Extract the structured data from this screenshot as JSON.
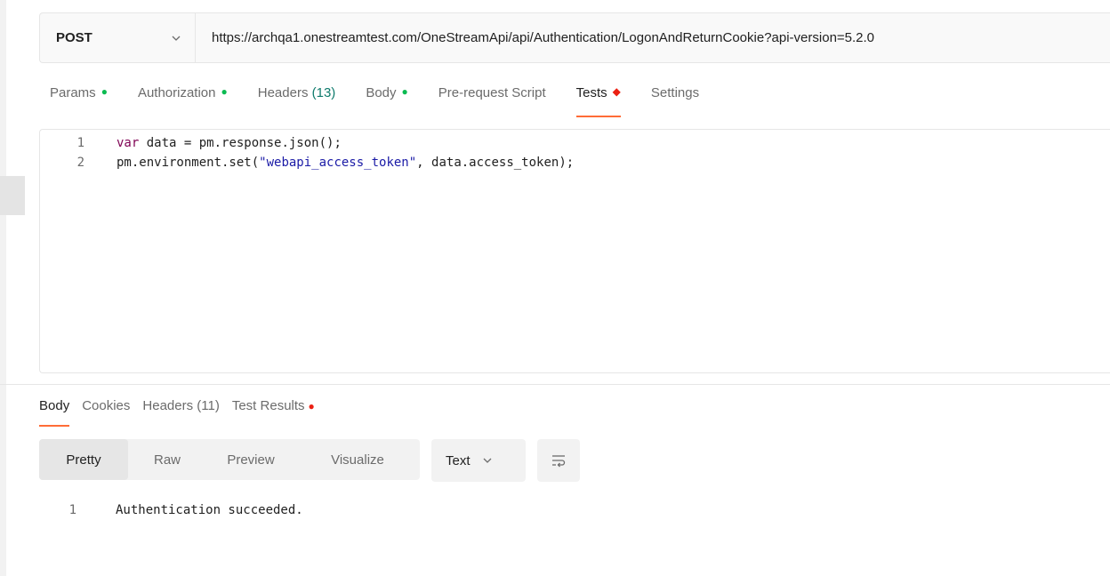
{
  "request": {
    "method": "POST",
    "url": "https://archqa1.onestreamtest.com/OneStreamApi/api/Authentication/LogonAndReturnCookie?api-version=5.2.0"
  },
  "request_tabs": [
    {
      "label": "Params",
      "indicator": "●"
    },
    {
      "label": "Authorization",
      "indicator": "●"
    },
    {
      "label": "Headers",
      "count": "(13)"
    },
    {
      "label": "Body",
      "indicator": "●"
    },
    {
      "label": "Pre-request Script"
    },
    {
      "label": "Tests",
      "indicator": "◆"
    },
    {
      "label": "Settings"
    }
  ],
  "editor": {
    "lines": [
      {
        "num": "1",
        "kw": "var",
        "rest": " data = pm.response.json();"
      },
      {
        "num": "2",
        "pre": "pm.environment.set(",
        "str": "\"webapi_access_token\"",
        "post": ", data.access_token);"
      }
    ]
  },
  "response_tabs": [
    {
      "label": "Body"
    },
    {
      "label": "Cookies"
    },
    {
      "label": "Headers (11)"
    },
    {
      "label": "Test Results",
      "indicator": "●"
    }
  ],
  "view_modes": [
    "Pretty",
    "Raw",
    "Preview",
    "Visualize"
  ],
  "format": "Text",
  "response_body": {
    "num": "1",
    "text": "Authentication succeeded."
  },
  "colors": {
    "accent": "#ff6c37",
    "green": "#0cbb52",
    "red": "#eb2013"
  },
  "icons": {
    "method_dropdown": "chevron-down-icon",
    "format_dropdown": "chevron-down-icon",
    "wrap": "word-wrap-icon"
  }
}
